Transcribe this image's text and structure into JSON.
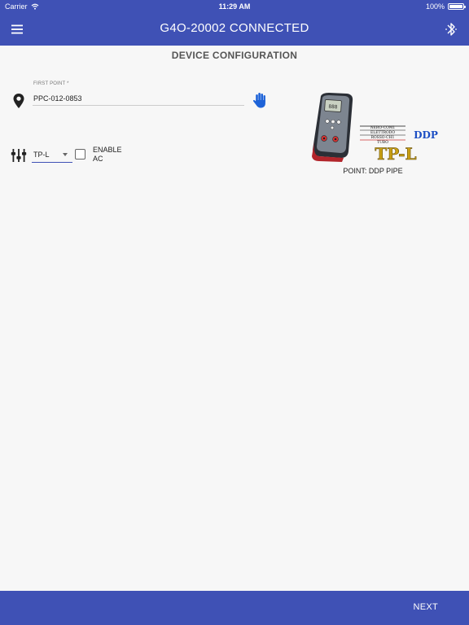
{
  "status_bar": {
    "carrier": "Carrier",
    "time": "11:29 AM",
    "battery_text": "100%",
    "battery_level": 1.0
  },
  "app_bar": {
    "title": "G4O-20002 CONNECTED",
    "menu_icon": "hamburger-menu-icon",
    "bluetooth_icon": "bluetooth-icon",
    "background_color": "#3f51b5"
  },
  "section": {
    "title": "DEVICE CONFIGURATION"
  },
  "first_point": {
    "label": "FIRST POINT *",
    "value": "PPC-012-0853",
    "location_icon": "map-pin-icon",
    "hand_icon": "hand-icon",
    "hand_color": "#1e63d8"
  },
  "mode": {
    "selected": "TP-L",
    "equalizer_icon": "sliders-icon"
  },
  "enable_ac": {
    "label_line1": "ENABLE",
    "label_line2": "AC",
    "checked": false
  },
  "device_image": {
    "wire_labels": [
      "NERO-COM1",
      "ELETTRODO",
      "ROSSO-CH1",
      "TUBO"
    ],
    "badge_blue": "DDP",
    "badge_gold": "TP-L",
    "screen_text": "888",
    "caption": "POINT: DDP PIPE"
  },
  "bottom_bar": {
    "next_label": "NEXT"
  }
}
